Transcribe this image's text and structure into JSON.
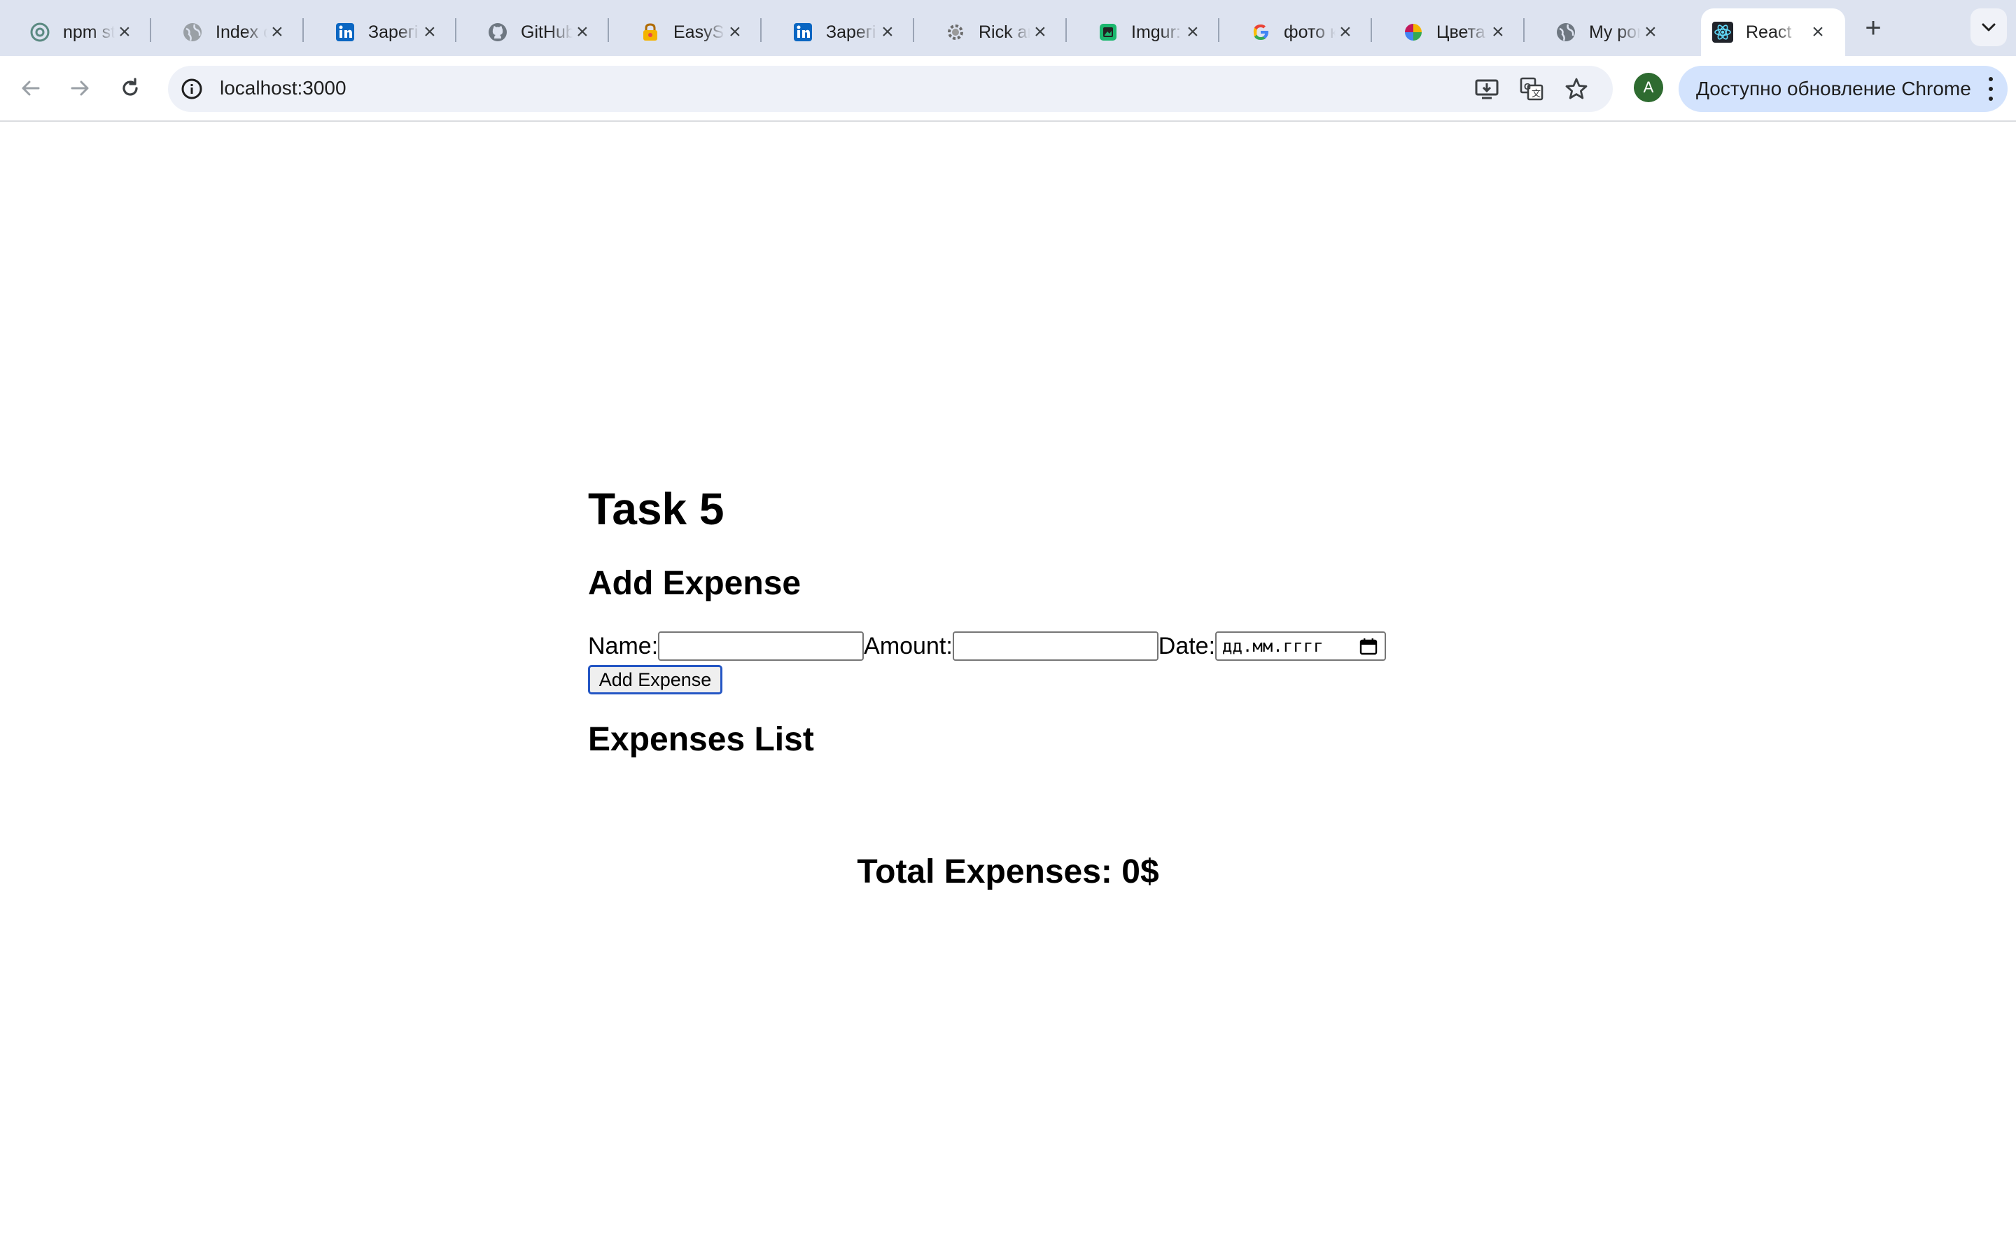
{
  "browser": {
    "tabs": [
      {
        "title": "npm st",
        "icon": "chatgpt-icon"
      },
      {
        "title": "Index o",
        "icon": "globe-icon"
      },
      {
        "title": "Зарегi",
        "icon": "linkedin-icon"
      },
      {
        "title": "GitHub",
        "icon": "github-icon"
      },
      {
        "title": "EasySl",
        "icon": "lock-icon"
      },
      {
        "title": "Зарегi",
        "icon": "linkedin-icon"
      },
      {
        "title": "Rick ar",
        "icon": "gear-icon"
      },
      {
        "title": "Imgur:",
        "icon": "imgur-icon"
      },
      {
        "title": "фото к",
        "icon": "google-icon"
      },
      {
        "title": "Цвета",
        "icon": "color-wheel-icon"
      },
      {
        "title": "My por",
        "icon": "globe-icon"
      },
      {
        "title": "React",
        "icon": "react-icon",
        "active": true
      }
    ],
    "url": "localhost:3000",
    "profile_initial": "A",
    "update_button_label": "Доступно обновление Chrome",
    "accent_color": "#d3e3fd",
    "tabstrip_color": "#dde3f0"
  },
  "page": {
    "title": "Task 5",
    "add_heading": "Add Expense",
    "form": {
      "name_label": "Name:",
      "name_value": "",
      "amount_label": "Amount:",
      "amount_value": "",
      "date_label": "Date:",
      "date_placeholder": "дд.мм.гггг",
      "submit_label": "Add Expense"
    },
    "list_heading": "Expenses List",
    "expenses": [],
    "total_label": "Total Expenses: 0$"
  }
}
